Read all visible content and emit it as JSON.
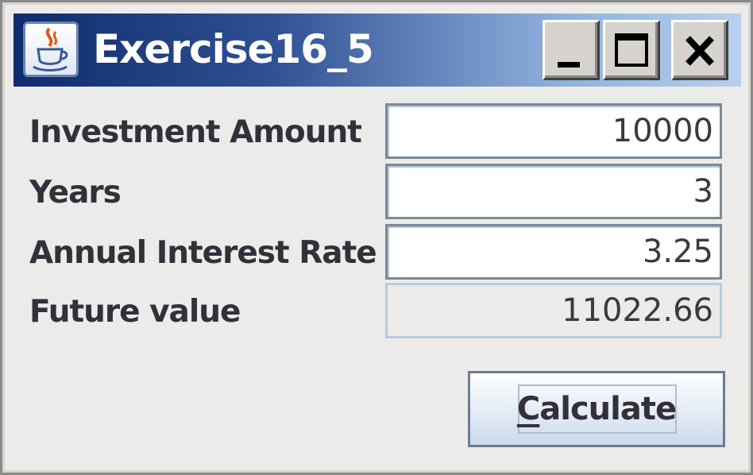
{
  "window": {
    "title": "Exercise16_5",
    "app_icon": "java-cup-icon",
    "controls": {
      "minimize_icon": "minimize-icon",
      "maximize_icon": "maximize-icon",
      "close_icon": "close-icon"
    }
  },
  "form": {
    "investment_amount": {
      "label": "Investment Amount",
      "value": "10000"
    },
    "years": {
      "label": "Years",
      "value": "3"
    },
    "annual_interest_rate": {
      "label": "Annual Interest Rate",
      "value": "3.25"
    },
    "future_value": {
      "label": "Future value",
      "value": "11022.66"
    }
  },
  "actions": {
    "calculate": {
      "mnemonic": "C",
      "rest": "alculate"
    }
  }
}
